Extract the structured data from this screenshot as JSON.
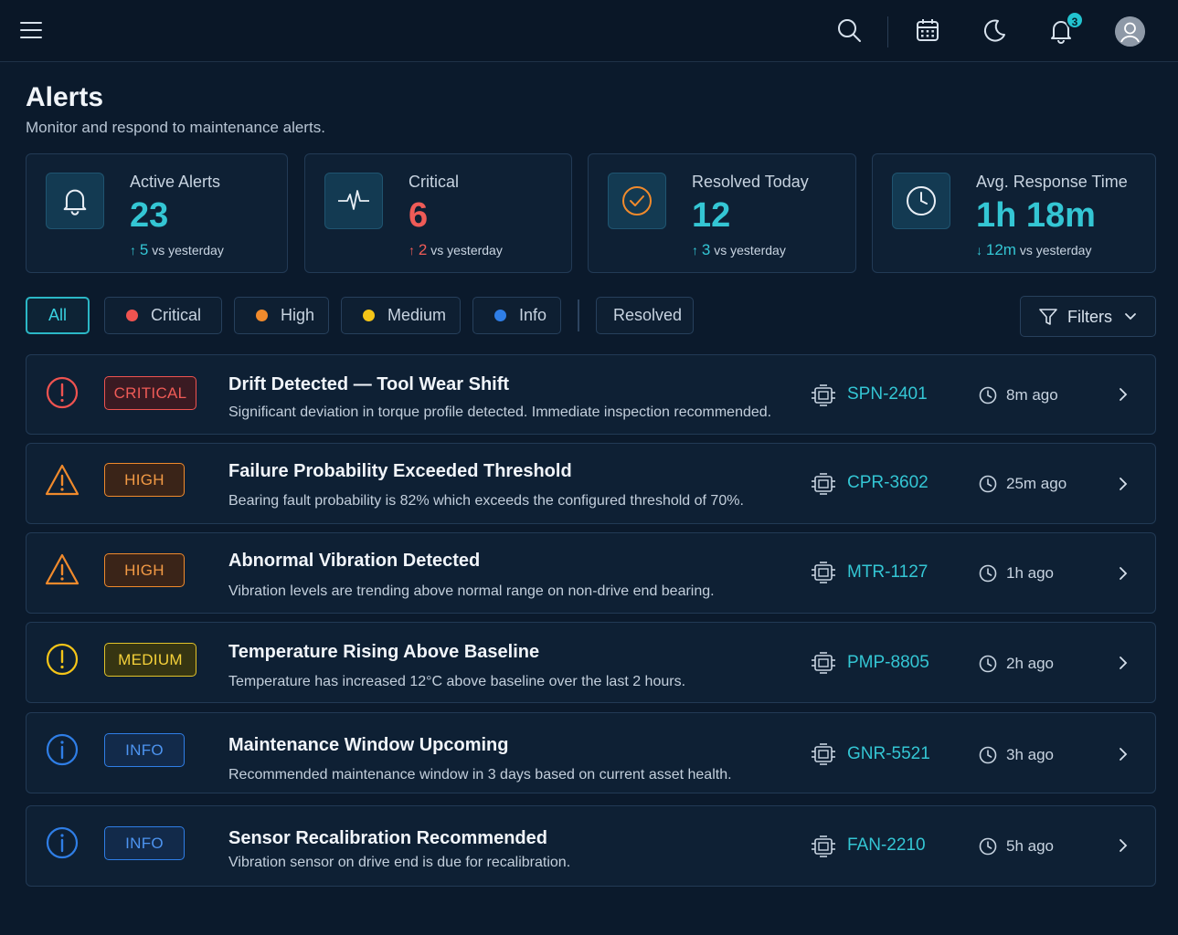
{
  "header": {
    "title": "Alerts",
    "subtitle": "Monitor and respond to maintenance alerts.",
    "notification_count": "3"
  },
  "stats": [
    {
      "label": "Active Alerts",
      "value": "23",
      "delta": "5",
      "delta_suffix": "vs yesterday",
      "direction": "up",
      "value_color": "#34c6d4",
      "delta_color": "#34c6d4",
      "icon": "bell-icon"
    },
    {
      "label": "Critical",
      "value": "6",
      "delta": "2",
      "delta_suffix": "vs yesterday",
      "direction": "up",
      "value_color": "#ef5b57",
      "delta_color": "#ef5b57",
      "icon": "pulse-icon"
    },
    {
      "label": "Resolved Today",
      "value": "12",
      "delta": "3",
      "delta_suffix": "vs yesterday",
      "direction": "up",
      "value_color": "#34c6d4",
      "delta_color": "#34c6d4",
      "icon": "check-circle-icon"
    },
    {
      "label": "Avg. Response Time",
      "value": "1h 18m",
      "delta": "12m",
      "delta_suffix": "vs yesterday",
      "direction": "down",
      "value_color": "#34c6d4",
      "delta_color": "#34c6d4",
      "icon": "clock-icon"
    }
  ],
  "filters": {
    "tabs": [
      {
        "label": "All",
        "active": true
      },
      {
        "label": "Critical",
        "dot_color": "#ef5350"
      },
      {
        "label": "High",
        "dot_color": "#f08a2c"
      },
      {
        "label": "Medium",
        "dot_color": "#f5c518"
      },
      {
        "label": "Info",
        "dot_color": "#2f7ee6"
      },
      {
        "label": "Resolved"
      }
    ],
    "filters_button": "Filters"
  },
  "alerts": [
    {
      "severity": "CRITICAL",
      "title": "Drift Detected — Tool Wear Shift",
      "description": "Significant deviation in torque profile detected. Immediate inspection recommended.",
      "asset": "SPN-2401",
      "time": "8m ago",
      "color": "#ef5350"
    },
    {
      "severity": "HIGH",
      "title": "Failure Probability Exceeded Threshold",
      "description": "Bearing fault probability is 82% which exceeds the configured threshold of 70%.",
      "asset": "CPR-3602",
      "time": "25m ago",
      "color": "#f08a2c"
    },
    {
      "severity": "HIGH",
      "title": "Abnormal Vibration Detected",
      "description": "Vibration levels are trending above normal range on non-drive end bearing.",
      "asset": "MTR-1127",
      "time": "1h ago",
      "color": "#f08a2c"
    },
    {
      "severity": "MEDIUM",
      "title": "Temperature Rising Above Baseline",
      "description": "Temperature has increased 12°C above baseline over the last 2 hours.",
      "asset": "PMP-8805",
      "time": "2h ago",
      "color": "#f5c518"
    },
    {
      "severity": "INFO",
      "title": "Maintenance Window Upcoming",
      "description": "Recommended maintenance window in 3 days based on current asset health.",
      "asset": "GNR-5521",
      "time": "3h ago",
      "color": "#2f7ee6"
    },
    {
      "severity": "INFO",
      "title": "Sensor Recalibration Recommended",
      "description": "Vibration sensor on drive end is due for recalibration.",
      "asset": "FAN-2210",
      "time": "5h ago",
      "color": "#2f7ee6"
    }
  ]
}
